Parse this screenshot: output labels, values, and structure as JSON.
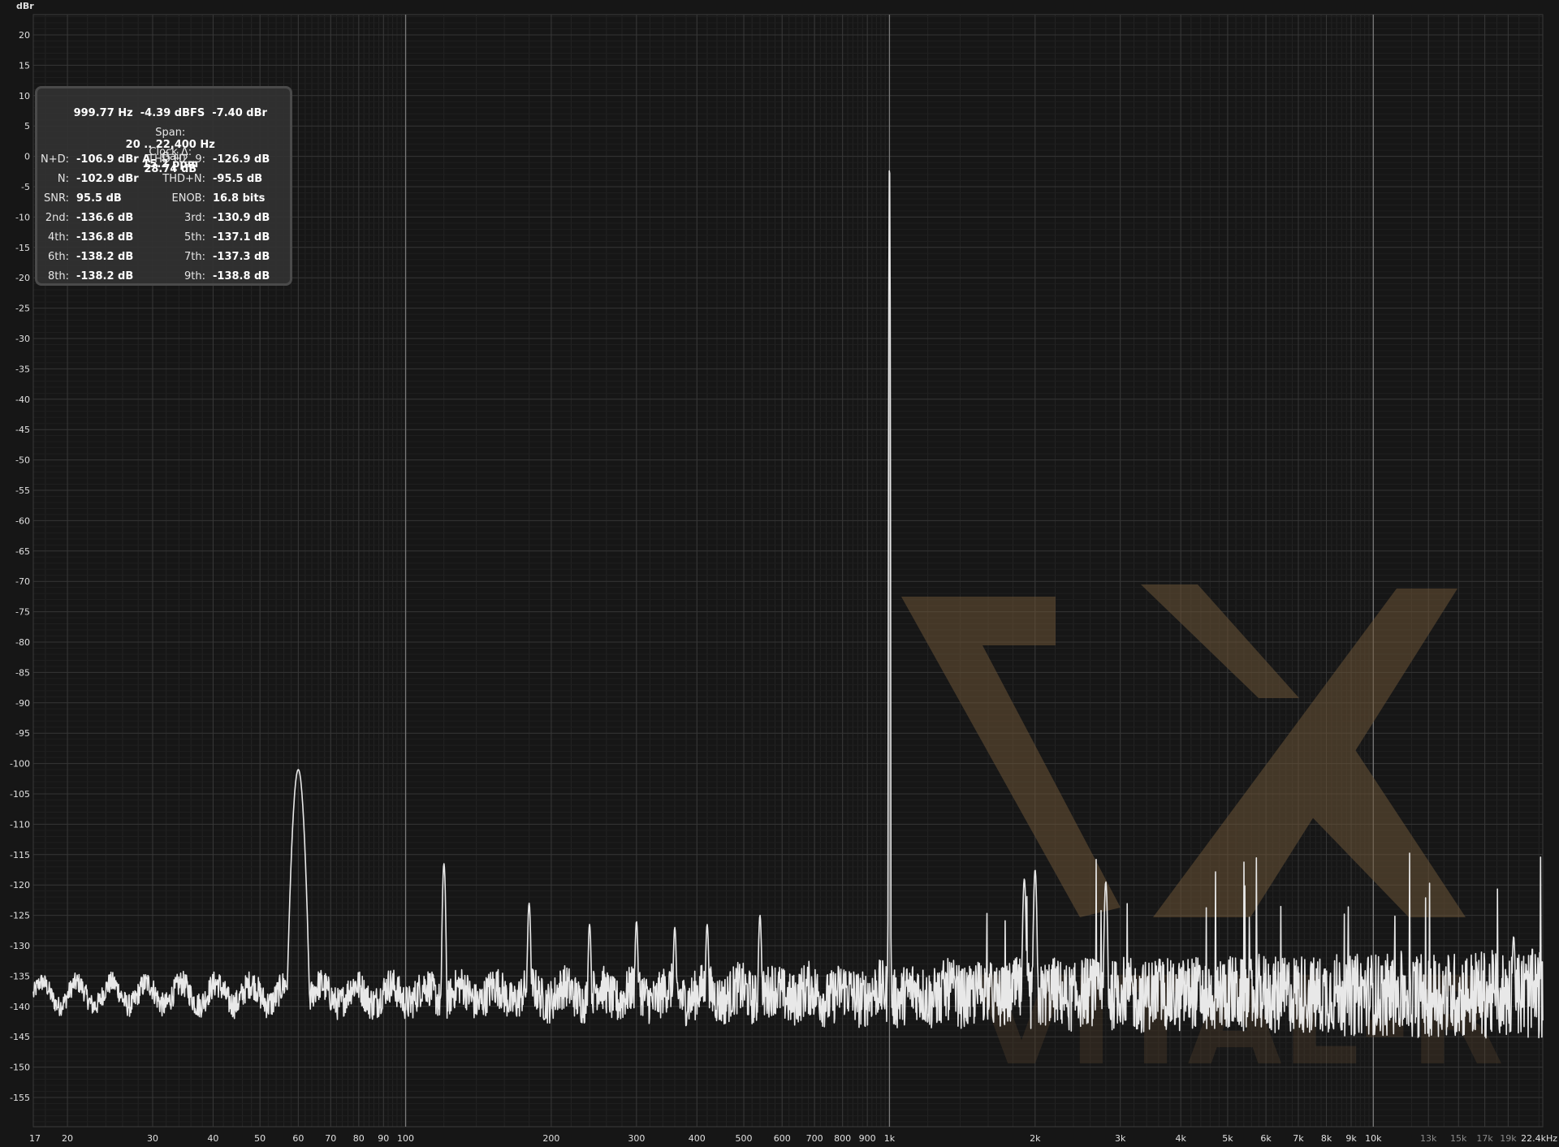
{
  "chart_data": {
    "type": "line",
    "ylabel": "dBr",
    "xscale": "log",
    "xlim": [
      17,
      22400
    ],
    "ylim": [
      -160,
      25
    ],
    "grid": true,
    "y_ticks": [
      20,
      15,
      10,
      5,
      0,
      -5,
      -10,
      -15,
      -20,
      -25,
      -30,
      -35,
      -40,
      -45,
      -50,
      -55,
      -60,
      -65,
      -70,
      -75,
      -80,
      -85,
      -90,
      -95,
      -100,
      -105,
      -110,
      -115,
      -120,
      -125,
      -130,
      -135,
      -140,
      -145,
      -150,
      -155
    ],
    "x_ticks": [
      {
        "value": 17,
        "label": "17"
      },
      {
        "value": 20,
        "label": "20"
      },
      {
        "value": 30,
        "label": "30"
      },
      {
        "value": 40,
        "label": "40"
      },
      {
        "value": 50,
        "label": "50"
      },
      {
        "value": 60,
        "label": "60"
      },
      {
        "value": 70,
        "label": "70"
      },
      {
        "value": 80,
        "label": "80"
      },
      {
        "value": 90,
        "label": "90"
      },
      {
        "value": 100,
        "label": "100"
      },
      {
        "value": 200,
        "label": "200"
      },
      {
        "value": 300,
        "label": "300"
      },
      {
        "value": 400,
        "label": "400"
      },
      {
        "value": 500,
        "label": "500"
      },
      {
        "value": 600,
        "label": "600"
      },
      {
        "value": 700,
        "label": "700"
      },
      {
        "value": 800,
        "label": "800"
      },
      {
        "value": 900,
        "label": "900"
      },
      {
        "value": 1000,
        "label": "1k"
      },
      {
        "value": 2000,
        "label": "2k"
      },
      {
        "value": 3000,
        "label": "3k"
      },
      {
        "value": 4000,
        "label": "4k"
      },
      {
        "value": 5000,
        "label": "5k"
      },
      {
        "value": 6000,
        "label": "6k"
      },
      {
        "value": 7000,
        "label": "7k"
      },
      {
        "value": 8000,
        "label": "8k"
      },
      {
        "value": 9000,
        "label": "9k"
      },
      {
        "value": 10000,
        "label": "10k"
      },
      {
        "value": 13000,
        "label": "13k",
        "dim": true
      },
      {
        "value": 15000,
        "label": "15k",
        "dim": true
      },
      {
        "value": 17000,
        "label": "17k",
        "dim": true
      },
      {
        "value": 19000,
        "label": "19k",
        "dim": true
      },
      {
        "value": 22400,
        "label": "22.4kHz"
      }
    ],
    "noise_floor_db": -138,
    "peaks": [
      {
        "x": 60,
        "y": -101
      },
      {
        "x": 120,
        "y": -116.5
      },
      {
        "x": 180,
        "y": -123
      },
      {
        "x": 240,
        "y": -126.5
      },
      {
        "x": 300,
        "y": -126
      },
      {
        "x": 360,
        "y": -127
      },
      {
        "x": 420,
        "y": -126.5
      },
      {
        "x": 540,
        "y": -125
      },
      {
        "x": 1000,
        "y": 0
      },
      {
        "x": 1900,
        "y": -119
      },
      {
        "x": 2000,
        "y": -117.5
      },
      {
        "x": 2800,
        "y": -119.5
      },
      {
        "x": 19500,
        "y": -128.5
      }
    ],
    "series": [
      {
        "name": "",
        "color": "#e8e8e8"
      }
    ]
  },
  "readout": {
    "marker": "999.77 Hz  -4.39 dBFS  -7.40 dBr",
    "span_label": "Span:",
    "span_value": "20 .. 22,400 Hz",
    "gain_label": "Gain",
    "gain_value": "28.74 dB",
    "clock_label": "Clock Δ:",
    "clock_value": "15.2 ppm",
    "rows": [
      {
        "l_label": "N+D:",
        "l_value": "-106.9 dBr A",
        "r_label": "THD H2..9:",
        "r_value": "-126.9 dB"
      },
      {
        "l_label": "N:",
        "l_value": "-102.9 dBr",
        "r_label": "THD+N:",
        "r_value": "-95.5 dB"
      },
      {
        "l_label": "SNR:",
        "l_value": "95.5 dB",
        "r_label": "ENOB:",
        "r_value": "16.8 bits"
      },
      {
        "l_label": "2nd:",
        "l_value": "-136.6 dB",
        "r_label": "3rd:",
        "r_value": "-130.9 dB"
      },
      {
        "l_label": "4th:",
        "l_value": "-136.8 dB",
        "r_label": "5th:",
        "r_value": "-137.1 dB"
      },
      {
        "l_label": "6th:",
        "l_value": "-138.2 dB",
        "r_label": "7th:",
        "r_value": "-137.3 dB"
      },
      {
        "l_label": "8th:",
        "l_value": "-138.2 dB",
        "r_label": "9th:",
        "r_value": "-138.8 dB"
      }
    ]
  },
  "watermark": {
    "text": "VITAL-R",
    "color": "#6b5437"
  }
}
